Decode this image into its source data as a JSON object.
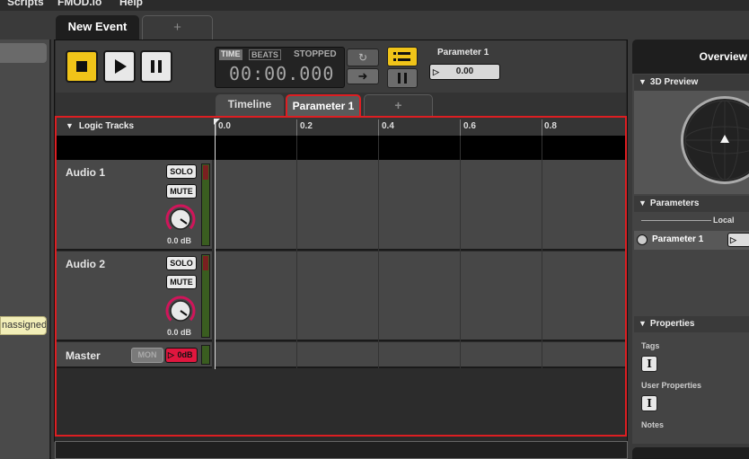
{
  "menubar": {
    "items": [
      "Scripts",
      "FMOD.io",
      "Help"
    ]
  },
  "left_panel": {
    "badge_text": "nassigned"
  },
  "event_tabs": {
    "active": "New Event",
    "add": "+"
  },
  "transport": {
    "time_label": "TIME",
    "beats_label": "BEATS",
    "status": "STOPPED",
    "timecode": "00:00.000",
    "parameter_name": "Parameter 1",
    "parameter_value": "0.00"
  },
  "sub_tabs": {
    "timeline": "Timeline",
    "parameter": "Parameter 1",
    "add": "+"
  },
  "tracks": {
    "header": "Logic Tracks",
    "ruler_ticks": [
      "0.0",
      "0.2",
      "0.4",
      "0.6",
      "0.8"
    ],
    "items": [
      {
        "name": "Audio 1",
        "solo": "SOLO",
        "mute": "MUTE",
        "volume": "0.0 dB"
      },
      {
        "name": "Audio 2",
        "solo": "SOLO",
        "mute": "MUTE",
        "volume": "0.0 dB"
      }
    ],
    "master": {
      "name": "Master",
      "mon": "MON",
      "volume": "0dB"
    }
  },
  "overview": {
    "title": "Overview",
    "preview_section": "3D Preview",
    "parameters_section": "Parameters",
    "local_label": "Local",
    "parameter_item": "Parameter 1",
    "properties_section": "Properties",
    "tags_label": "Tags",
    "user_properties_label": "User Properties",
    "notes_label": "Notes"
  },
  "colors": {
    "accent_yellow": "#f0c419",
    "highlight_red": "#dd1e22",
    "master_red": "#e0163e"
  }
}
